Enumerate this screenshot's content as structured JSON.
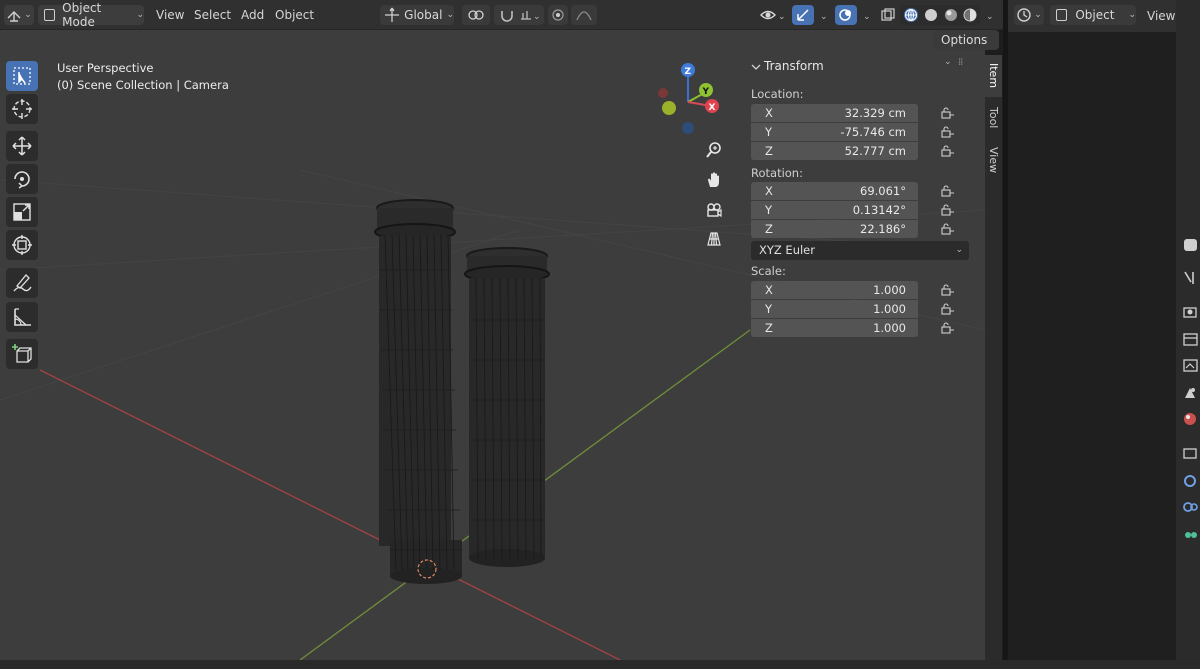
{
  "header": {
    "mode_label": "Object Mode",
    "menus": [
      "View",
      "Select",
      "Add",
      "Object"
    ],
    "orientation_label": "Global"
  },
  "viewport": {
    "perspective_label": "User Perspective",
    "collection_label": "(0) Scene Collection | Camera",
    "options_label": "Options",
    "gizmo_axes": {
      "x": "X",
      "y": "Y",
      "z": "Z"
    }
  },
  "transform_panel": {
    "title": "Transform",
    "location_label": "Location:",
    "location": [
      {
        "axis": "X",
        "value": "32.329 cm"
      },
      {
        "axis": "Y",
        "value": "-75.746 cm"
      },
      {
        "axis": "Z",
        "value": "52.777 cm"
      }
    ],
    "rotation_label": "Rotation:",
    "rotation": [
      {
        "axis": "X",
        "value": "69.061°"
      },
      {
        "axis": "Y",
        "value": "0.13142°"
      },
      {
        "axis": "Z",
        "value": "22.186°"
      }
    ],
    "rotation_mode": "XYZ Euler",
    "scale_label": "Scale:",
    "scale": [
      {
        "axis": "X",
        "value": "1.000"
      },
      {
        "axis": "Y",
        "value": "1.000"
      },
      {
        "axis": "Z",
        "value": "1.000"
      }
    ]
  },
  "side_tabs": [
    "Item",
    "Tool",
    "View"
  ],
  "right_editor": {
    "object_label": "Object",
    "view_label": "View"
  },
  "colors": {
    "accent": "#4772b3",
    "viewport_bg": "#3d3d3d",
    "axis_x": "#c44a4a",
    "axis_y": "#7aa03a"
  },
  "icons": {
    "tools": [
      "select-box-icon",
      "cursor-icon",
      "move-icon",
      "rotate-icon",
      "scale-icon",
      "transform-icon",
      "annotate-icon",
      "measure-icon",
      "add-cube-icon"
    ],
    "nav": [
      "zoom-icon",
      "pan-hand-icon",
      "camera-view-icon",
      "grid-ortho-icon"
    ]
  }
}
